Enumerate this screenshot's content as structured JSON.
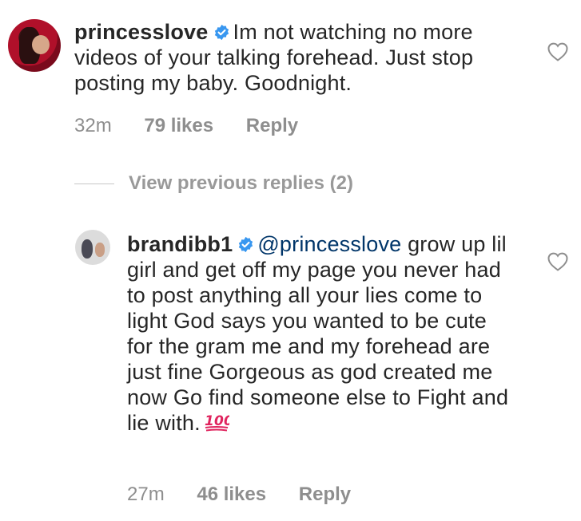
{
  "comments": [
    {
      "username": "princesslove",
      "text": "Im not watching no more videos of your talking forehead. Just stop posting my baby. Goodnight.",
      "time": "32m",
      "likes": "79 likes",
      "reply": "Reply"
    },
    {
      "username": "brandibb1",
      "mention": "@princesslove",
      "text": "grow up lil girl and get off my page you never had to post anything  all your lies come to light God says you wanted to be cute for the gram me and my forehead are just fine Gorgeous as god created me now Go find someone else to Fight and lie with.",
      "time": "27m",
      "likes": "46 likes",
      "reply": "Reply"
    }
  ],
  "thread": {
    "view_previous": "View previous replies (2)"
  },
  "colors": {
    "verified_blue": "#3897f0",
    "mention": "#003569",
    "meta_gray": "#8e8e8e",
    "emoji_red": "#e0245e"
  },
  "icons": {
    "verified": "verified-badge-icon",
    "like": "heart-outline-icon",
    "emoji": "hundred-points-emoji"
  }
}
